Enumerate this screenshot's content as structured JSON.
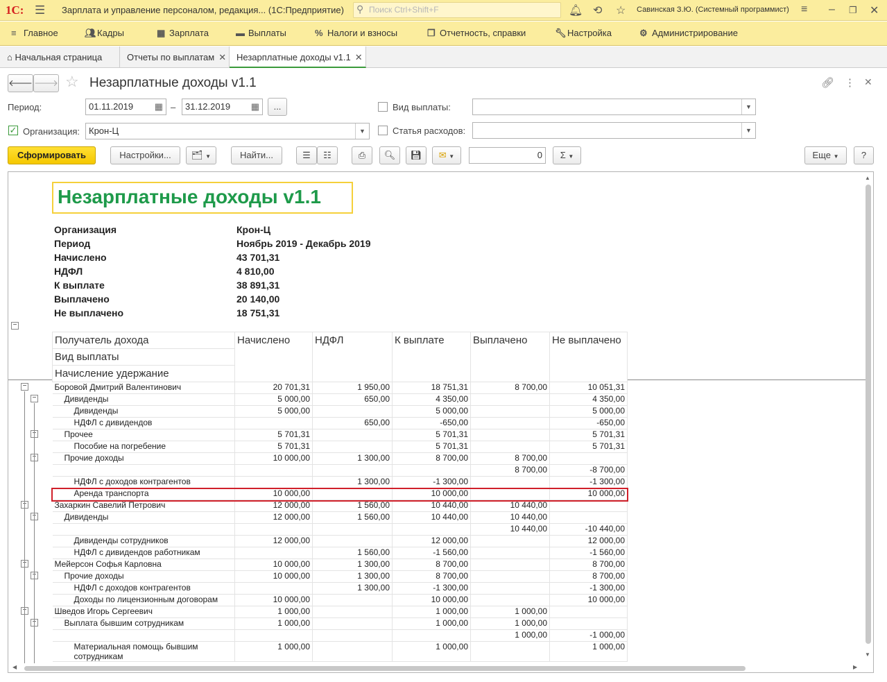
{
  "titlebar": {
    "logo": "1С:",
    "app_title": "Зарплата и управление персоналом, редакция... (1С:Предприятие)",
    "search_placeholder": "Поиск Ctrl+Shift+F",
    "user": "Савинская З.Ю. (Системный программист)"
  },
  "sections": [
    "Главное",
    "Кадры",
    "Зарплата",
    "Выплаты",
    "Налоги и взносы",
    "Отчетность, справки",
    "Настройка",
    "Администрирование"
  ],
  "tabs": {
    "home": "Начальная страница",
    "t1": "Отчеты по выплатам",
    "t2": "Незарплатные доходы v1.1"
  },
  "form": {
    "title": "Незарплатные доходы v1.1",
    "period_label": "Период:",
    "date_from": "01.11.2019",
    "dash": "–",
    "date_to": "31.12.2019",
    "dots": "...",
    "org_label": "Организация:",
    "org_value": "Крон-Ц",
    "pay_type_label": "Вид выплаты:",
    "expense_label": "Статья расходов:",
    "btn_generate": "Сформировать",
    "btn_settings": "Настройки...",
    "btn_find": "Найти...",
    "sum_value": "0",
    "btn_more": "Еще",
    "btn_help": "?"
  },
  "report": {
    "title": "Незарплатные доходы v1.1",
    "header": [
      {
        "k": "Организация",
        "v": "Крон-Ц"
      },
      {
        "k": "Период",
        "v": "Ноябрь 2019 - Декабрь 2019"
      },
      {
        "k": "Начислено",
        "v": "43 701,31"
      },
      {
        "k": "НДФЛ",
        "v": "4 810,00"
      },
      {
        "k": "К выплате",
        "v": "38 891,31"
      },
      {
        "k": "Выплачено",
        "v": "20 140,00"
      },
      {
        "k": "Не выплачено",
        "v": "18 751,31"
      }
    ],
    "col_group": [
      "Получатель дохода",
      "Вид выплаты",
      "Начисление удержание"
    ],
    "columns": [
      "Начислено",
      "НДФЛ",
      "К выплате",
      "Выплачено",
      "Не выплачено"
    ],
    "rows": [
      {
        "l": 0,
        "name": "Боровой Дмитрий Валентинович",
        "v": [
          "20 701,31",
          "1 950,00",
          "18 751,31",
          "8 700,00",
          "10 051,31"
        ]
      },
      {
        "l": 1,
        "name": "Дивиденды",
        "v": [
          "5 000,00",
          "650,00",
          "4 350,00",
          "",
          "4 350,00"
        ]
      },
      {
        "l": 2,
        "name": "Дивиденды",
        "v": [
          "5 000,00",
          "",
          "5 000,00",
          "",
          "5 000,00"
        ]
      },
      {
        "l": 2,
        "name": "НДФЛ с дивидендов",
        "v": [
          "",
          "650,00",
          "-650,00",
          "",
          "-650,00"
        ]
      },
      {
        "l": 1,
        "name": "Прочее",
        "v": [
          "5 701,31",
          "",
          "5 701,31",
          "",
          "5 701,31"
        ]
      },
      {
        "l": 2,
        "name": "Пособие на погребение",
        "v": [
          "5 701,31",
          "",
          "5 701,31",
          "",
          "5 701,31"
        ]
      },
      {
        "l": 1,
        "name": "Прочие доходы",
        "v": [
          "10 000,00",
          "1 300,00",
          "8 700,00",
          "8 700,00",
          ""
        ]
      },
      {
        "l": 2,
        "name": "",
        "v": [
          "",
          "",
          "",
          "8 700,00",
          "-8 700,00"
        ]
      },
      {
        "l": 2,
        "name": "НДФЛ с доходов контрагентов",
        "v": [
          "",
          "1 300,00",
          "-1 300,00",
          "",
          "-1 300,00"
        ]
      },
      {
        "l": 2,
        "name": "Аренда транспорта",
        "v": [
          "10 000,00",
          "",
          "10 000,00",
          "",
          "10 000,00"
        ]
      },
      {
        "l": 0,
        "name": "Захаркин Савелий Петрович",
        "v": [
          "12 000,00",
          "1 560,00",
          "10 440,00",
          "10 440,00",
          ""
        ]
      },
      {
        "l": 1,
        "name": "Дивиденды",
        "v": [
          "12 000,00",
          "1 560,00",
          "10 440,00",
          "10 440,00",
          ""
        ]
      },
      {
        "l": 2,
        "name": "",
        "v": [
          "",
          "",
          "",
          "10 440,00",
          "-10 440,00"
        ]
      },
      {
        "l": 2,
        "name": "Дивиденды сотрудников",
        "v": [
          "12 000,00",
          "",
          "12 000,00",
          "",
          "12 000,00"
        ]
      },
      {
        "l": 2,
        "name": "НДФЛ с дивидендов работникам",
        "v": [
          "",
          "1 560,00",
          "-1 560,00",
          "",
          "-1 560,00"
        ]
      },
      {
        "l": 0,
        "name": "Мейерсон Софья Карловна",
        "v": [
          "10 000,00",
          "1 300,00",
          "8 700,00",
          "",
          "8 700,00"
        ]
      },
      {
        "l": 1,
        "name": "Прочие доходы",
        "v": [
          "10 000,00",
          "1 300,00",
          "8 700,00",
          "",
          "8 700,00"
        ]
      },
      {
        "l": 2,
        "name": "НДФЛ с доходов контрагентов",
        "v": [
          "",
          "1 300,00",
          "-1 300,00",
          "",
          "-1 300,00"
        ]
      },
      {
        "l": 2,
        "name": "Доходы по лицензионным договорам",
        "v": [
          "10 000,00",
          "",
          "10 000,00",
          "",
          "10 000,00"
        ]
      },
      {
        "l": 0,
        "name": "Шведов Игорь Сергеевич",
        "v": [
          "1 000,00",
          "",
          "1 000,00",
          "1 000,00",
          ""
        ]
      },
      {
        "l": 1,
        "name": "Выплата бывшим сотрудникам",
        "v": [
          "1 000,00",
          "",
          "1 000,00",
          "1 000,00",
          ""
        ]
      },
      {
        "l": 2,
        "name": "",
        "v": [
          "",
          "",
          "",
          "1 000,00",
          "-1 000,00"
        ]
      },
      {
        "l": 2,
        "name": "Материальная помощь бывшим сотрудникам",
        "v": [
          "1 000,00",
          "",
          "1 000,00",
          "",
          "1 000,00"
        ]
      }
    ]
  }
}
